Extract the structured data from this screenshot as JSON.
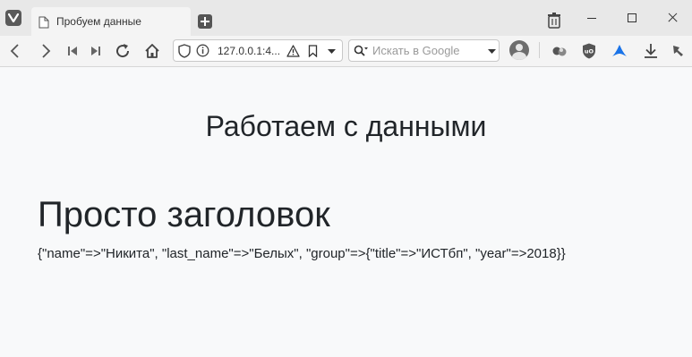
{
  "browser": {
    "tab_title": "Пробуем данные",
    "address_url": "127.0.0.1:4...",
    "search_placeholder": "Искать в Google"
  },
  "page": {
    "title": "Работаем с данными",
    "heading": "Просто заголовок",
    "data_text": "{\"name\"=>\"Никита\", \"last_name\"=>\"Белых\", \"group\"=>{\"title\"=>\"ИСТбп\", \"year\"=>2018}}"
  },
  "icons": [
    "vivaldi-logo-icon",
    "page-icon",
    "new-tab-icon",
    "trash-icon",
    "minimize-icon",
    "maximize-icon",
    "close-icon",
    "back-icon",
    "forward-icon",
    "rewind-icon",
    "fast-forward-icon",
    "reload-icon",
    "home-icon",
    "shield-icon",
    "info-icon",
    "warning-icon",
    "bookmark-icon",
    "search-engine-icon",
    "profile-avatar",
    "extension-icon",
    "ublock-icon",
    "extension-bird-icon",
    "download-icon"
  ],
  "colors": {
    "page_background": "#f8f9fa",
    "text": "#212529",
    "tabbar": "#e8e8e8",
    "toolbar": "#f4f4f4",
    "accent_blue": "#1a73e8"
  }
}
